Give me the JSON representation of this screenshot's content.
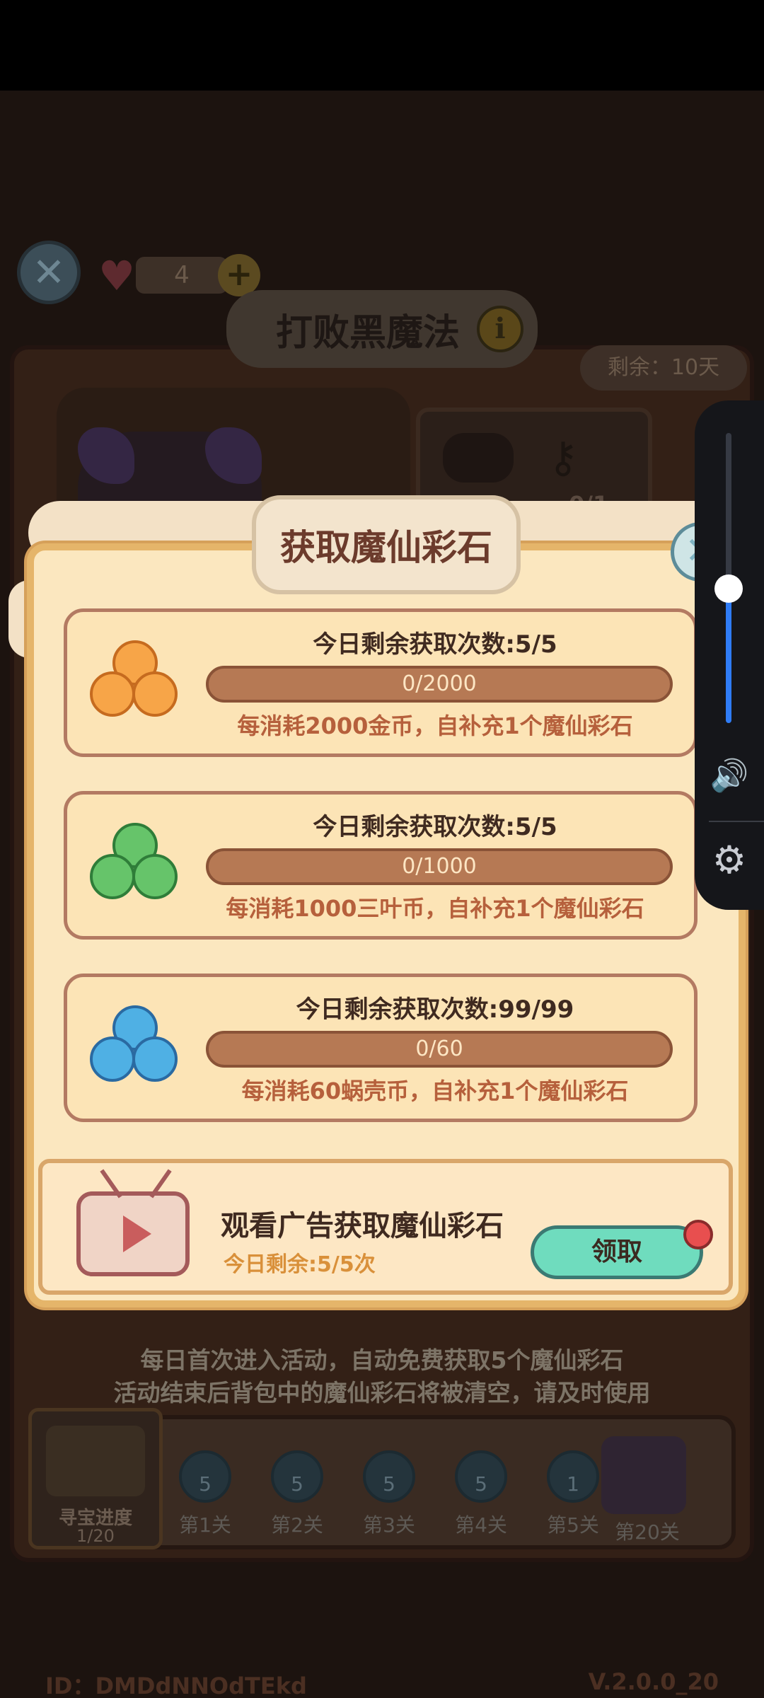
{
  "background": {
    "lives_count": "4",
    "event_title": "打败黑魔法",
    "remaining_days": "剩余：10天",
    "key_progress": "0/1",
    "tips": [
      "每日首次进入活动，自动免费获取5个魔仙彩石",
      "活动结束后背包中的魔仙彩石将被清空，请及时使用"
    ],
    "treasure": {
      "label": "寻宝进度",
      "count": "1/20"
    },
    "stages": [
      {
        "label": "第1关",
        "value": "5"
      },
      {
        "label": "第2关",
        "value": "5"
      },
      {
        "label": "第3关",
        "value": "5"
      },
      {
        "label": "第4关",
        "value": "5"
      },
      {
        "label": "第5关",
        "value": "1"
      }
    ],
    "final_stage": "第20关",
    "footer_id": "ID：DMDdNNOdTEkd",
    "version": "V.2.0.0_20"
  },
  "modal": {
    "title": "获取魔仙彩石",
    "cards": [
      {
        "title": "今日剩余获取次数:5/5",
        "progress": "0/2000",
        "desc": "每消耗2000金币，自补充1个魔仙彩石",
        "coin": "gold-coin-icon",
        "color": "#f7a548",
        "border": "#c66b1f"
      },
      {
        "title": "今日剩余获取次数:5/5",
        "progress": "0/1000",
        "desc": "每消耗1000三叶币，自补充1个魔仙彩石",
        "coin": "clover-coin-icon",
        "color": "#66c46a",
        "border": "#2f7d39"
      },
      {
        "title": "今日剩余获取次数:99/99",
        "progress": "0/60",
        "desc": "每消耗60蜗壳币，自补充1个魔仙彩石",
        "coin": "shell-coin-icon",
        "color": "#4fb0e4",
        "border": "#2a6aa2"
      }
    ],
    "ad": {
      "title": "观看广告获取魔仙彩石",
      "remaining": "今日剩余:5/5次",
      "claim_label": "领取"
    }
  },
  "icons": {
    "close": "✕",
    "heart": "♥",
    "plus": "+",
    "info": "i",
    "key": "⚷",
    "speaker": "🔊",
    "gear": "⚙"
  },
  "volume_level": 0.44
}
